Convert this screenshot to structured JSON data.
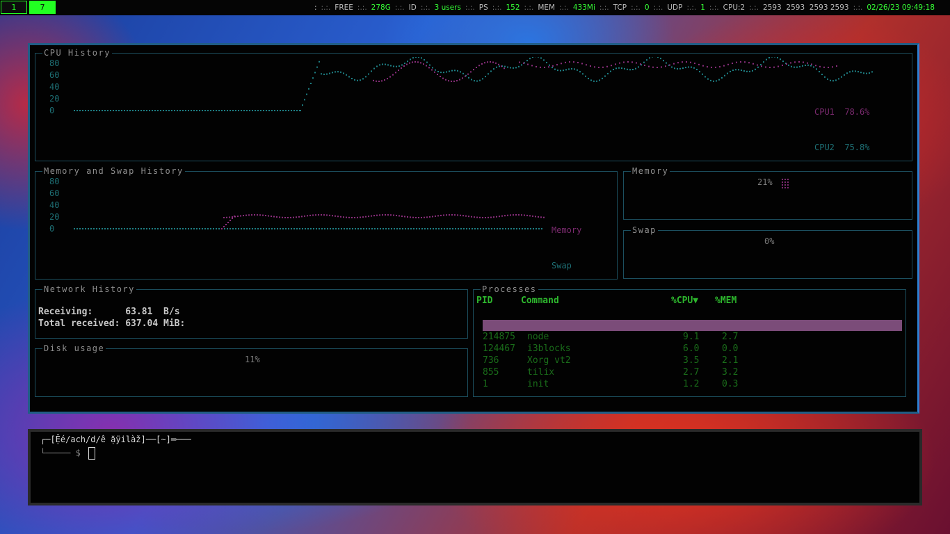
{
  "topbar": {
    "workspaces": [
      "1",
      "7"
    ],
    "active_workspace": "7",
    "status": {
      "lead": ":",
      "sep": ":.:.",
      "free_label": "FREE",
      "free_value": "278G",
      "id_label": "ID",
      "id_value": "3 users",
      "ps_label": "PS",
      "ps_value": "152",
      "mem_label": "MEM",
      "mem_value": "433Mi",
      "tcp_label": "TCP",
      "tcp_value": "0",
      "udp_label": "UDP",
      "udp_value": "1",
      "cpu_label": "CPU:2",
      "cpu_freqs": "2593  2593  2593 2593",
      "datetime": "02/26/23 09:49:18"
    }
  },
  "btop": {
    "cpu_history": {
      "title": "CPU History",
      "y_ticks": [
        "80",
        "60",
        "40",
        "20",
        "0"
      ],
      "legend": [
        {
          "name": "CPU1",
          "value": "78.6%",
          "color": "#7a2a6e"
        },
        {
          "name": "CPU2",
          "value": "75.8%",
          "color": "#1e6f74"
        }
      ]
    },
    "mem_history": {
      "title": "Memory and Swap History",
      "y_ticks": [
        "80",
        "60",
        "40",
        "20",
        "0"
      ],
      "legend": [
        {
          "name": "Memory",
          "color": "#7a2a6e"
        },
        {
          "name": "Swap",
          "color": "#1e6f74"
        }
      ]
    },
    "memory": {
      "title": "Memory",
      "percent": "21%"
    },
    "swap": {
      "title": "Swap",
      "percent": "0%"
    },
    "network": {
      "title": "Network History",
      "receiving_label": "Receiving:",
      "receiving_value": "63.81  B/s",
      "total_label": "Total received:",
      "total_value": "637.04 MiB:"
    },
    "disk": {
      "title": "Disk usage",
      "percent": "11%"
    },
    "processes": {
      "title": "Processes",
      "columns": {
        "pid": "PID",
        "command": "Command",
        "cpu": "%CPU▼",
        "mem": "%MEM"
      },
      "rows": [
        {
          "pid": "214875",
          "command": "node",
          "cpu": "9.1",
          "mem": "2.7"
        },
        {
          "pid": "124467",
          "command": "i3blocks",
          "cpu": "6.0",
          "mem": "0.0"
        },
        {
          "pid": "736",
          "command": "Xorg vt2",
          "cpu": "3.5",
          "mem": "2.1"
        },
        {
          "pid": "855",
          "command": "tilix",
          "cpu": "2.7",
          "mem": "3.2"
        },
        {
          "pid": "1",
          "command": "init",
          "cpu": "1.2",
          "mem": "0.3"
        }
      ]
    }
  },
  "terminal": {
    "prompt_line1": "┌─[Ệé/ach/d/ê ặÿilàž]──[~]═───",
    "prompt_line2": "└───── $ "
  },
  "colors": {
    "accent_green": "#36ff36",
    "btop_border": "#205d86",
    "box_border": "#1c4f5f"
  }
}
